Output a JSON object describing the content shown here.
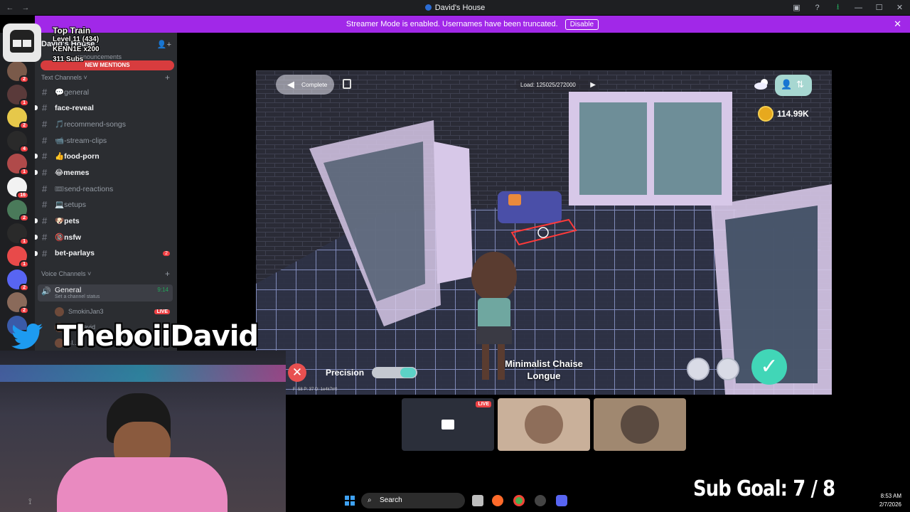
{
  "window": {
    "title": "David's House"
  },
  "banner": {
    "text": "Streamer Mode is enabled. Usernames have been truncated.",
    "disable_label": "Disable"
  },
  "server": {
    "name": "David's House",
    "new_mentions": "NEW MENTIONS",
    "announcements": "announcements"
  },
  "top_train": {
    "title": "Top Train",
    "level": "Level 11 (434)",
    "user": "KENN1E x200",
    "subs": "311 Subs"
  },
  "rail_badges": [
    "2",
    "1",
    "2",
    "4",
    "1",
    "16",
    "2",
    "1",
    "1",
    "2",
    "2",
    "1"
  ],
  "sidebar": {
    "text_category": "Text Channels",
    "voice_category": "Voice Channels",
    "channels": [
      {
        "name": "💬general",
        "unread": false
      },
      {
        "name": "face-reveal",
        "unread": true
      },
      {
        "name": "🎵recommend-songs",
        "unread": false
      },
      {
        "name": "📹-stream-clips",
        "unread": false
      },
      {
        "name": "👍food-porn",
        "unread": true
      },
      {
        "name": "😂memes",
        "unread": true
      },
      {
        "name": "🎟send-reactions",
        "unread": false
      },
      {
        "name": "💻setups",
        "unread": false
      },
      {
        "name": "🐶pets",
        "unread": true
      },
      {
        "name": "🔞nsfw",
        "unread": true
      },
      {
        "name": "bet-parlays",
        "unread": true,
        "badge": "2"
      }
    ],
    "voice": {
      "name": "General",
      "time": "9:14",
      "status": "Set a channel status"
    },
    "voice_users": [
      {
        "name": "SmokinJan3",
        "live": "LIVE"
      },
      {
        "name": "...oiidavid",
        "live": ""
      },
      {
        "name": "sl...",
        "live": ""
      }
    ]
  },
  "game": {
    "complete_label": "Complete",
    "load_text": "Load: 125025/272000",
    "coins": "114.99K",
    "precision_label": "Precision",
    "item_name_1": "Minimalist Chaise",
    "item_name_2": "Longue",
    "debug_text": "F: 58  P: 37  D: 1e4k7rr0"
  },
  "tiles": [
    {
      "live": "LIVE"
    }
  ],
  "overlay": {
    "handle": "TheboiiDavid",
    "sub_goal": "Sub Goal:  7 / 8"
  },
  "taskbar": {
    "search_placeholder": "Search",
    "time": "8:53 AM",
    "date": "2/7/2026"
  },
  "colors": {
    "banner": "#a128e8",
    "confirm": "#41d6b7",
    "coin": "#e7a91e"
  }
}
